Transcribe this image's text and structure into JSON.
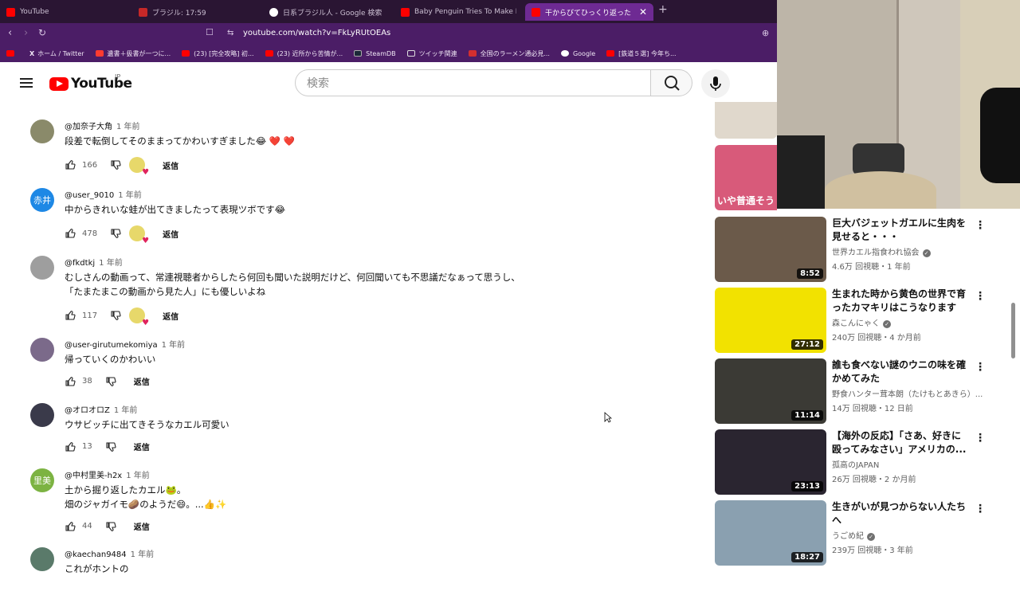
{
  "browser": {
    "tabs": [
      {
        "label": "YouTube",
        "favicon_color": "#ff0000"
      },
      {
        "label": "ブラジル: 17:59",
        "favicon_color": "#c62828"
      },
      {
        "label": "日系ブラジル人 - Google 検索",
        "favicon_color": "#ffffff"
      },
      {
        "label": "Baby Penguin Tries To Make Friends |",
        "favicon_color": "#ff0000"
      },
      {
        "label": "干からびてひっくり返ったカエルに水を",
        "favicon_color": "#ff0000"
      }
    ],
    "url": "youtube.com/watch?v=FkLyRUtOEAs",
    "bookmarks": [
      {
        "label": "ホーム / Twitter",
        "color": "#ffffff"
      },
      {
        "label": "遺書＋扱書が一つに...",
        "color": "#ff3b30"
      },
      {
        "label": "(23) [完全攻略] 初...",
        "color": "#ff0000"
      },
      {
        "label": "(23) 近所から苦情が...",
        "color": "#ff0000"
      },
      {
        "label": "SteamDB",
        "color": "#1b2838"
      },
      {
        "label": "ツイッチ関連",
        "color": "#dddddd"
      },
      {
        "label": "全国のラーメン通必見...",
        "color": "#d32f2f"
      },
      {
        "label": "Google",
        "color": "#4285f4"
      },
      {
        "label": "[鉄道５選] 今年ち...",
        "color": "#ff0000"
      }
    ]
  },
  "header": {
    "logo_text": "YouTube",
    "region": "JP",
    "search_placeholder": "検索"
  },
  "comments": [
    {
      "author": "@加奈子大角",
      "time": "1 年前",
      "text": [
        "段差で転倒してそのままってかわいすぎました😂 ❤️ ❤️"
      ],
      "likes": "166",
      "hearted": true,
      "avatar_color": "#8a8a6a",
      "avatar_text": ""
    },
    {
      "author": "@user_9010",
      "time": "1 年前",
      "text": [
        "中からきれいな蛙が出てきましたって表現ツボです😂"
      ],
      "likes": "478",
      "hearted": true,
      "avatar_color": "#1e88e5",
      "avatar_text": "赤井"
    },
    {
      "author": "@fkdtkj",
      "time": "1 年前",
      "text": [
        "むしさんの動画って、常連視聴者からしたら何回も聞いた説明だけど、何回聞いても不思議だなぁって思うし、",
        "「たまたまこの動画から見た人」にも優しいよね"
      ],
      "likes": "117",
      "hearted": true,
      "avatar_color": "#9e9e9e",
      "avatar_text": ""
    },
    {
      "author": "@user-girutumekomiya",
      "time": "1 年前",
      "text": [
        "帰っていくのかわいい"
      ],
      "likes": "38",
      "hearted": false,
      "avatar_color": "#7b6a8a",
      "avatar_text": ""
    },
    {
      "author": "@オロオロZ",
      "time": "1 年前",
      "text": [
        "ウサビッチに出てきそうなカエル可愛い"
      ],
      "likes": "13",
      "hearted": false,
      "avatar_color": "#3a3a4a",
      "avatar_text": ""
    },
    {
      "author": "@中村里美-h2x",
      "time": "1 年前",
      "text": [
        "土から掘り返したカエル🐸。",
        "畑のジャガイモ🥔のようだ😄。...👍✨"
      ],
      "likes": "44",
      "hearted": false,
      "avatar_color": "#7cb342",
      "avatar_text": "里美"
    },
    {
      "author": "@kaechan9484",
      "time": "1 年前",
      "text": [
        "これがホントの"
      ],
      "likes": "",
      "hearted": false,
      "avatar_color": "#5a7a6a",
      "avatar_text": ""
    }
  ],
  "reply_label": "返信",
  "sidebar": [
    {
      "title": "巨大バジェットガエルに生肉を見せると・・・",
      "channel": "世界カエル指食われ協会",
      "verified": true,
      "meta": "4.6万 回視聴・1 年前",
      "duration": "8:52",
      "thumb_color": "#6b5a4a"
    },
    {
      "title": "生まれた時から黄色の世界で育ったカマキリはこうなります",
      "channel": "森こんにゃく",
      "verified": true,
      "meta": "240万 回視聴・4 か月前",
      "duration": "27:12",
      "thumb_color": "#f2e200"
    },
    {
      "title": "誰も食べない謎のウニの味を確かめてみた",
      "channel": "野食ハンター茸本朗（たけもとあきら）...",
      "verified": false,
      "meta": "14万 回視聴・12 日前",
      "duration": "11:14",
      "thumb_color": "#3b3a35"
    },
    {
      "title": "【海外の反応】「さあ、好きに殴ってみなさい」アメリカの...",
      "channel": "孤高のJAPAN",
      "verified": false,
      "meta": "26万 回視聴・2 か月前",
      "duration": "23:13",
      "thumb_color": "#2a2530"
    },
    {
      "title": "生きがいが見つからない人たちへ",
      "channel": "うごめ紀",
      "verified": true,
      "meta": "239万 回視聴・3 年前",
      "duration": "18:27",
      "thumb_color": "#8aa0b0"
    }
  ],
  "partial_thumbs": [
    {
      "text": "",
      "color": "#e0d8cc"
    },
    {
      "text": "いや普通そう",
      "color": "#d85a7a"
    }
  ]
}
